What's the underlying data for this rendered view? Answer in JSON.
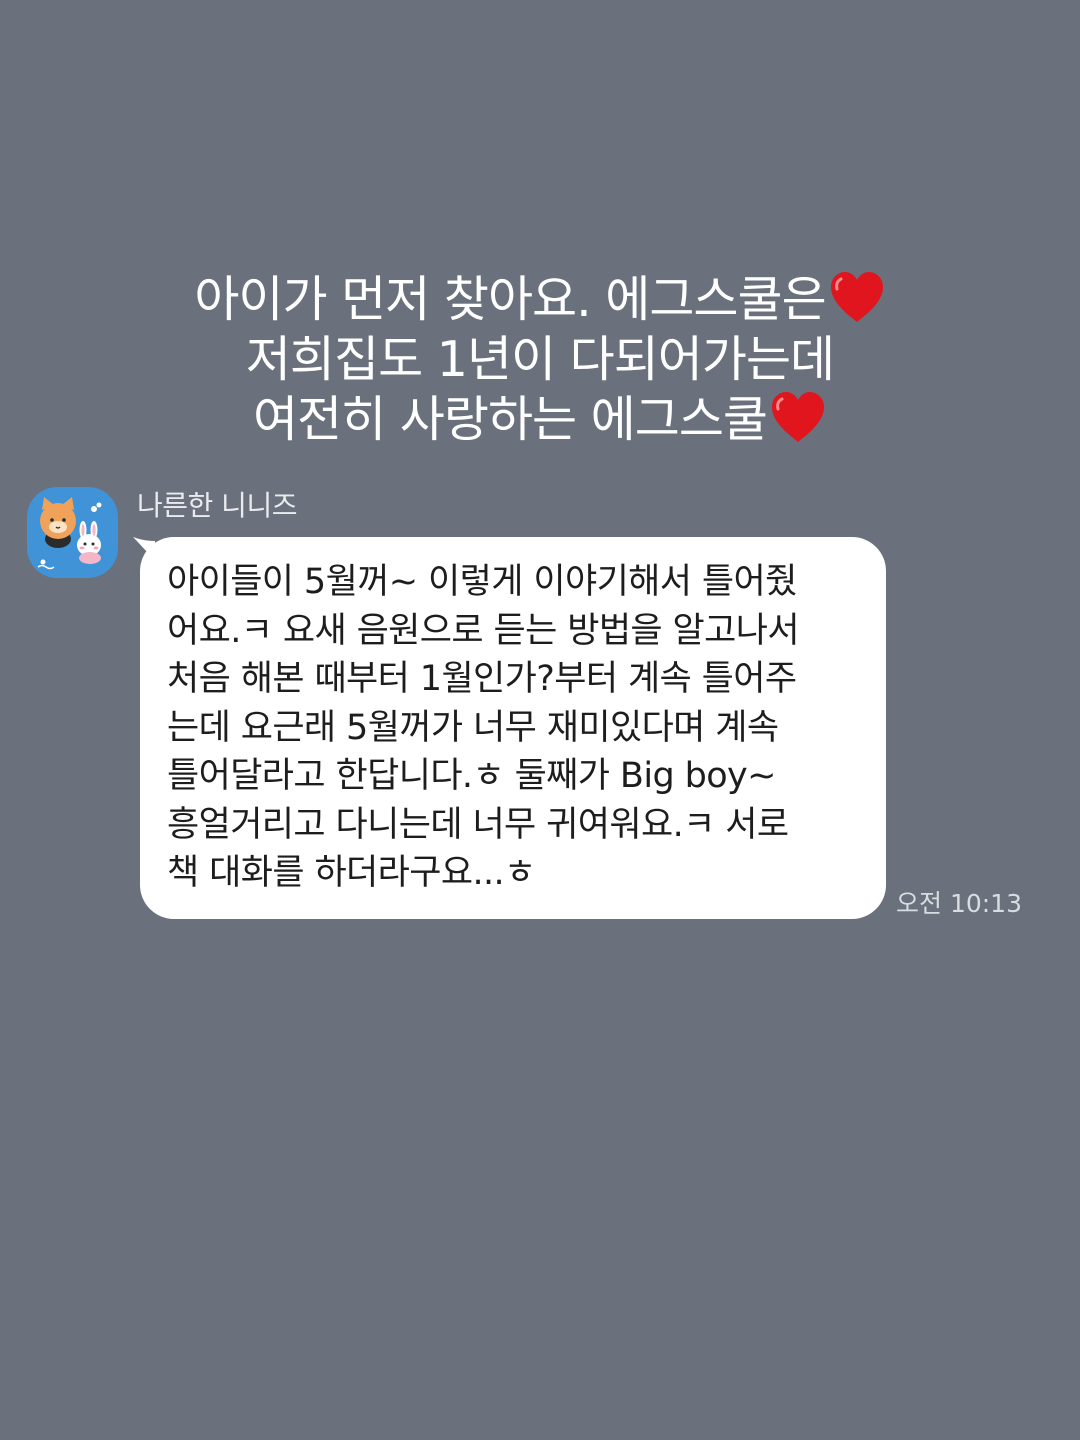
{
  "caption": {
    "lines": [
      "아이가 먼저 찾아요. 에그스쿨은",
      "저희집도 1년이 다되어가는데",
      "여전히 사랑하는 에그스쿨"
    ],
    "emoji": "heart-emoji"
  },
  "chat": {
    "sender_name": "나른한 니니즈",
    "avatar": "character-avatar",
    "message_lines": [
      "아이들이 5월꺼~ 이렇게 이야기해서 틀어줬",
      "어요.ㅋ 요새 음원으로 듣는 방법을 알고나서",
      "처음 해본 때부터 1월인가?부터 계속 틀어주",
      "는데 요근래 5월꺼가 너무 재미있다며 계속",
      "틀어달라고 한답니다.ㅎ 둘째가 Big boy~",
      "흥얼거리고 다니는데 너무 귀여워요.ㅋ 서로",
      "책 대화를 하더라구요...ㅎ"
    ],
    "time": "오전 10:13"
  },
  "colors": {
    "background": "#6a707c",
    "bubble": "#ffffff",
    "avatar_bg": "#3f93d6",
    "heart": "#e0151d"
  }
}
